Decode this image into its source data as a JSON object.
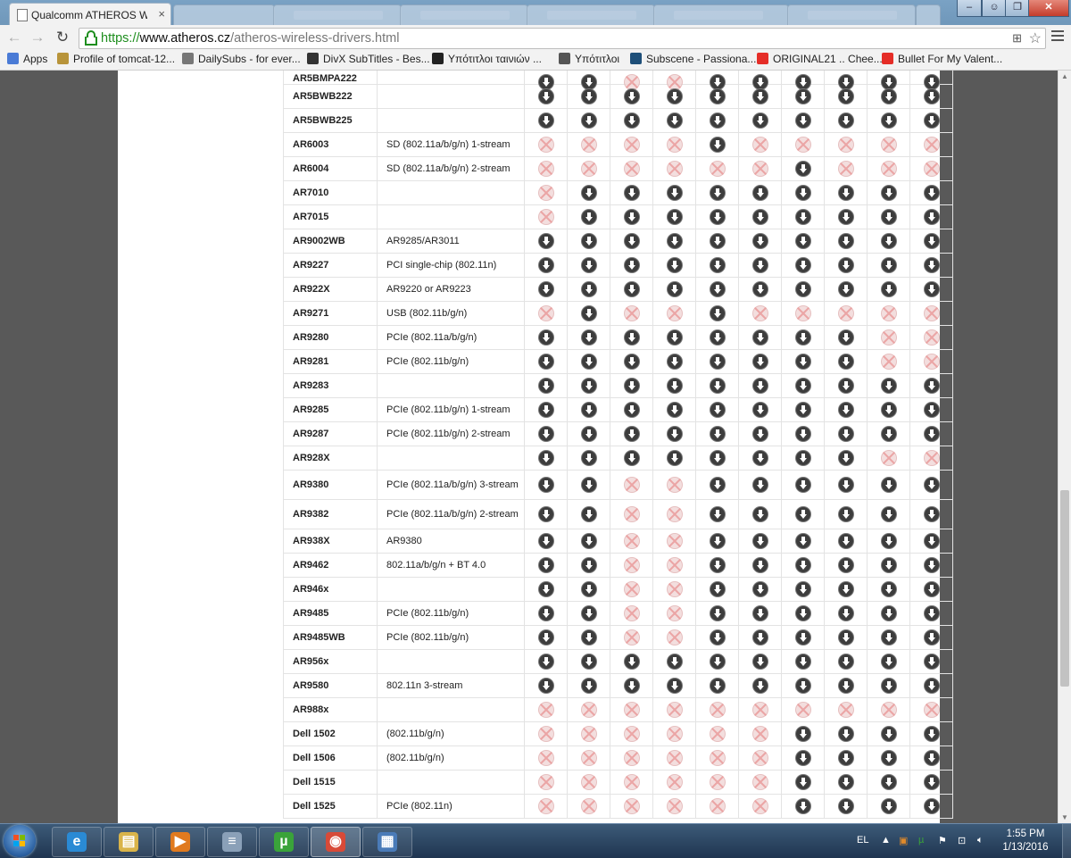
{
  "browser": {
    "active_tab_title": "Qualcomm ATHEROS Wire",
    "url_scheme": "https://",
    "url_host": "www.atheros.cz",
    "url_path": "/atheros-wireless-drivers.html",
    "bookmarks": [
      {
        "label": "Apps",
        "icon": "apps-grid-icon",
        "color": "#4a7bd6"
      },
      {
        "label": "Profile of tomcat-12...",
        "icon": "shield-icon",
        "color": "#b8943a"
      },
      {
        "label": "DailySubs - for ever...",
        "icon": "face-icon",
        "color": "#777777"
      },
      {
        "label": "DivX SubTitles - Bes...",
        "icon": "sunglasses-icon",
        "color": "#333333"
      },
      {
        "label": "Υπότιτλοι ταινιών ...",
        "icon": "film-icon",
        "color": "#222222"
      },
      {
        "label": "Υπότιτλοι",
        "icon": "document-icon",
        "color": "#555555"
      },
      {
        "label": "Subscene - Passiona...",
        "icon": "s-logo-icon",
        "color": "#1e4f79"
      },
      {
        "label": "ORIGINAL21 .. Chee...",
        "icon": "youtube-icon",
        "color": "#e52d27"
      },
      {
        "label": "Bullet For My Valent...",
        "icon": "youtube-icon",
        "color": "#e52d27"
      }
    ]
  },
  "table": {
    "partial_top_label": "AR5BMPA222",
    "rows": [
      {
        "model": "AR5BWB222",
        "desc": "",
        "cells": [
          "d",
          "d",
          "d",
          "d",
          "d",
          "d",
          "d",
          "d",
          "d",
          "d"
        ]
      },
      {
        "model": "AR5BWB225",
        "desc": "",
        "cells": [
          "d",
          "d",
          "d",
          "d",
          "d",
          "d",
          "d",
          "d",
          "d",
          "d"
        ]
      },
      {
        "model": "AR6003",
        "desc": "SD (802.11a/b/g/n) 1-stream",
        "cells": [
          "x",
          "x",
          "x",
          "x",
          "d",
          "x",
          "x",
          "x",
          "x",
          "x"
        ]
      },
      {
        "model": "AR6004",
        "desc": "SD (802.11a/b/g/n) 2-stream",
        "cells": [
          "x",
          "x",
          "x",
          "x",
          "x",
          "x",
          "d",
          "x",
          "x",
          "x"
        ]
      },
      {
        "model": "AR7010",
        "desc": "",
        "cells": [
          "x",
          "d",
          "d",
          "d",
          "d",
          "d",
          "d",
          "d",
          "d",
          "d"
        ]
      },
      {
        "model": "AR7015",
        "desc": "",
        "cells": [
          "x",
          "d",
          "d",
          "d",
          "d",
          "d",
          "d",
          "d",
          "d",
          "d"
        ]
      },
      {
        "model": "AR9002WB",
        "desc": "AR9285/AR3011",
        "cells": [
          "d",
          "d",
          "d",
          "d",
          "d",
          "d",
          "d",
          "d",
          "d",
          "d"
        ]
      },
      {
        "model": "AR9227",
        "desc": "PCI single-chip (802.11n)",
        "cells": [
          "d",
          "d",
          "d",
          "d",
          "d",
          "d",
          "d",
          "d",
          "d",
          "d"
        ]
      },
      {
        "model": "AR922X",
        "desc": "AR9220 or AR9223",
        "cells": [
          "d",
          "d",
          "d",
          "d",
          "d",
          "d",
          "d",
          "d",
          "d",
          "d"
        ]
      },
      {
        "model": "AR9271",
        "desc": "USB (802.11b/g/n)",
        "cells": [
          "x",
          "d",
          "x",
          "x",
          "d",
          "x",
          "x",
          "x",
          "x",
          "x"
        ]
      },
      {
        "model": "AR9280",
        "desc": "PCIe (802.11a/b/g/n)",
        "cells": [
          "d",
          "d",
          "d",
          "d",
          "d",
          "d",
          "d",
          "d",
          "x",
          "x"
        ]
      },
      {
        "model": "AR9281",
        "desc": "PCIe (802.11b/g/n)",
        "cells": [
          "d",
          "d",
          "d",
          "d",
          "d",
          "d",
          "d",
          "d",
          "x",
          "x"
        ]
      },
      {
        "model": "AR9283",
        "desc": "",
        "cells": [
          "d",
          "d",
          "d",
          "d",
          "d",
          "d",
          "d",
          "d",
          "d",
          "d"
        ]
      },
      {
        "model": "AR9285",
        "desc": "PCIe (802.11b/g/n) 1-stream",
        "cells": [
          "d",
          "d",
          "d",
          "d",
          "d",
          "d",
          "d",
          "d",
          "d",
          "d"
        ]
      },
      {
        "model": "AR9287",
        "desc": "PCIe (802.11b/g/n) 2-stream",
        "cells": [
          "d",
          "d",
          "d",
          "d",
          "d",
          "d",
          "d",
          "d",
          "d",
          "d"
        ]
      },
      {
        "model": "AR928X",
        "desc": "",
        "cells": [
          "d",
          "d",
          "d",
          "d",
          "d",
          "d",
          "d",
          "d",
          "x",
          "x"
        ]
      },
      {
        "model": "AR9380",
        "desc": "PCIe (802.11a/b/g/n) 3-stream",
        "tall": true,
        "cells": [
          "d",
          "d",
          "x",
          "x",
          "d",
          "d",
          "d",
          "d",
          "d",
          "d"
        ]
      },
      {
        "model": "AR9382",
        "desc": "PCIe (802.11a/b/g/n) 2-stream",
        "tall": true,
        "cells": [
          "d",
          "d",
          "x",
          "x",
          "d",
          "d",
          "d",
          "d",
          "d",
          "d"
        ]
      },
      {
        "model": "AR938X",
        "desc": "AR9380",
        "cells": [
          "d",
          "d",
          "x",
          "x",
          "d",
          "d",
          "d",
          "d",
          "d",
          "d"
        ]
      },
      {
        "model": "AR9462",
        "desc": "802.11a/b/g/n + BT 4.0",
        "cells": [
          "d",
          "d",
          "x",
          "x",
          "d",
          "d",
          "d",
          "d",
          "d",
          "d"
        ]
      },
      {
        "model": "AR946x",
        "desc": "",
        "cells": [
          "d",
          "d",
          "x",
          "x",
          "d",
          "d",
          "d",
          "d",
          "d",
          "d"
        ]
      },
      {
        "model": "AR9485",
        "desc": "PCIe (802.11b/g/n)",
        "cells": [
          "d",
          "d",
          "x",
          "x",
          "d",
          "d",
          "d",
          "d",
          "d",
          "d"
        ]
      },
      {
        "model": "AR9485WB",
        "desc": "PCIe (802.11b/g/n)",
        "cells": [
          "d",
          "d",
          "x",
          "x",
          "d",
          "d",
          "d",
          "d",
          "d",
          "d"
        ]
      },
      {
        "model": "AR956x",
        "desc": "",
        "cells": [
          "d",
          "d",
          "d",
          "d",
          "d",
          "d",
          "d",
          "d",
          "d",
          "d"
        ]
      },
      {
        "model": "AR9580",
        "desc": "802.11n 3-stream",
        "cells": [
          "d",
          "d",
          "d",
          "d",
          "d",
          "d",
          "d",
          "d",
          "d",
          "d"
        ]
      },
      {
        "model": "AR988x",
        "desc": "",
        "cells": [
          "x",
          "x",
          "x",
          "x",
          "x",
          "x",
          "x",
          "x",
          "x",
          "x"
        ]
      },
      {
        "model": "Dell 1502",
        "desc": "(802.11b/g/n)",
        "cells": [
          "x",
          "x",
          "x",
          "x",
          "x",
          "x",
          "d",
          "d",
          "d",
          "d"
        ]
      },
      {
        "model": "Dell 1506",
        "desc": "(802.11b/g/n)",
        "cells": [
          "x",
          "x",
          "x",
          "x",
          "x",
          "x",
          "d",
          "d",
          "d",
          "d"
        ]
      },
      {
        "model": "Dell 1515",
        "desc": "",
        "cells": [
          "x",
          "x",
          "x",
          "x",
          "x",
          "x",
          "d",
          "d",
          "d",
          "d"
        ]
      },
      {
        "model": "Dell 1525",
        "desc": "PCIe (802.11n)",
        "cells": [
          "x",
          "x",
          "x",
          "x",
          "x",
          "x",
          "d",
          "d",
          "d",
          "d"
        ]
      }
    ]
  },
  "taskbar": {
    "language": "EL",
    "time": "1:55 PM",
    "date": "1/13/2016",
    "apps": [
      {
        "name": "internet-explorer",
        "glyph": "e",
        "color": "#2a8ad4"
      },
      {
        "name": "file-explorer",
        "glyph": "▤",
        "color": "#d9b44a"
      },
      {
        "name": "media-player",
        "glyph": "▶",
        "color": "#e07a1f"
      },
      {
        "name": "notepad-app",
        "glyph": "≡",
        "color": "#8aa0b8"
      },
      {
        "name": "utorrent",
        "glyph": "µ",
        "color": "#3aa33a"
      },
      {
        "name": "chrome",
        "glyph": "◉",
        "color": "#d84a38"
      },
      {
        "name": "remote-desktop",
        "glyph": "▦",
        "color": "#4a7bb8"
      }
    ]
  }
}
